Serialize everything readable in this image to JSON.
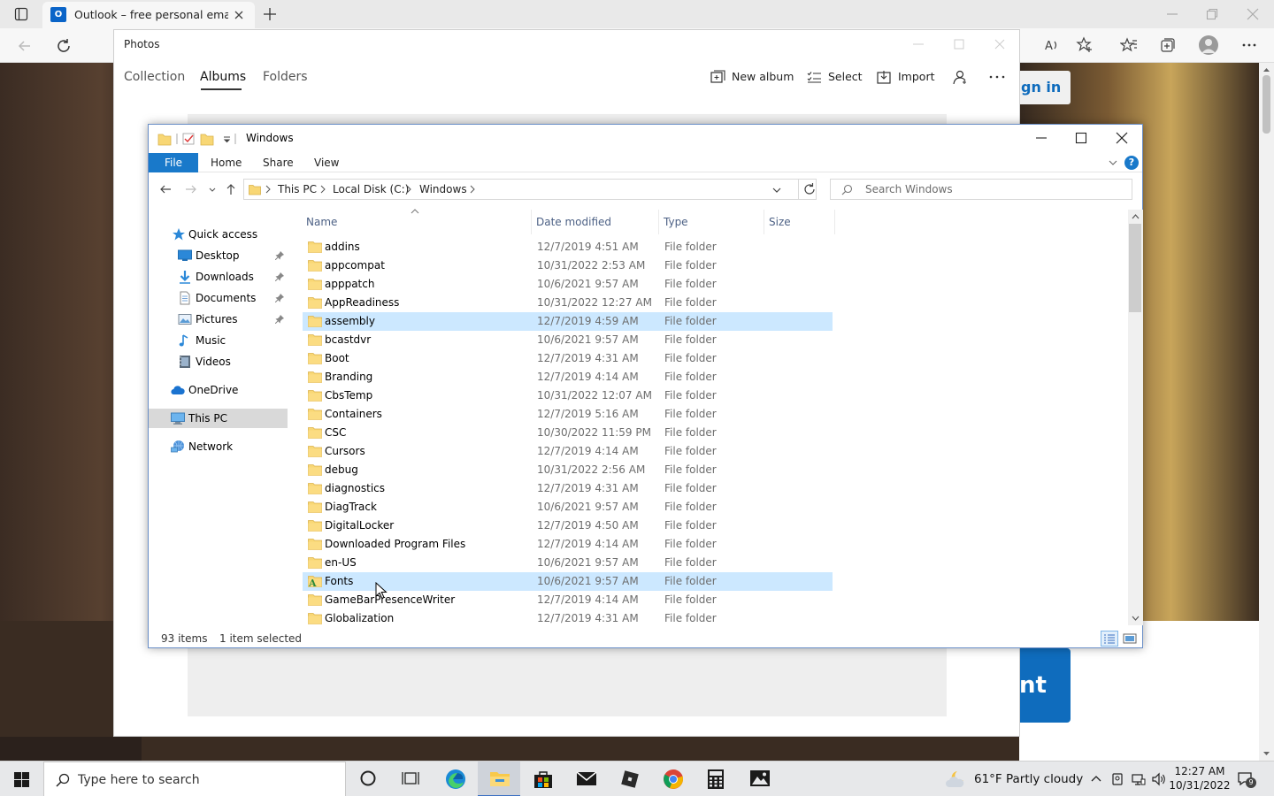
{
  "browser": {
    "tab_title": "Outlook – free personal email an",
    "web_signin_fragment": "gn in",
    "web_button_fragment": "nt"
  },
  "photos": {
    "title": "Photos",
    "nav": [
      "Collection",
      "Albums",
      "Folders"
    ],
    "active_nav": "Albums",
    "actions": {
      "new_album": "New album",
      "select": "Select",
      "import": "Import"
    }
  },
  "explorer": {
    "title": "Windows",
    "ribbon_tabs": [
      "File",
      "Home",
      "Share",
      "View"
    ],
    "breadcrumb": [
      "This PC",
      "Local Disk (C:)",
      "Windows"
    ],
    "search_placeholder": "Search Windows",
    "sidebar": [
      {
        "label": "Quick access",
        "icon": "star-icon"
      },
      {
        "label": "Desktop",
        "icon": "desktop-icon",
        "pinned": true
      },
      {
        "label": "Downloads",
        "icon": "download-icon",
        "pinned": true
      },
      {
        "label": "Documents",
        "icon": "documents-icon",
        "pinned": true
      },
      {
        "label": "Pictures",
        "icon": "pictures-icon",
        "pinned": true
      },
      {
        "label": "Music",
        "icon": "music-icon"
      },
      {
        "label": "Videos",
        "icon": "videos-icon"
      },
      {
        "label": "OneDrive",
        "icon": "cloud-icon"
      },
      {
        "label": "This PC",
        "icon": "computer-icon",
        "selected": true
      },
      {
        "label": "Network",
        "icon": "network-icon"
      }
    ],
    "columns": [
      "Name",
      "Date modified",
      "Type",
      "Size"
    ],
    "files": [
      {
        "name": "addins",
        "date": "12/7/2019 4:51 AM",
        "type": "File folder"
      },
      {
        "name": "appcompat",
        "date": "10/31/2022 2:53 AM",
        "type": "File folder"
      },
      {
        "name": "apppatch",
        "date": "10/6/2021 9:57 AM",
        "type": "File folder"
      },
      {
        "name": "AppReadiness",
        "date": "10/31/2022 12:27 AM",
        "type": "File folder"
      },
      {
        "name": "assembly",
        "date": "12/7/2019 4:59 AM",
        "type": "File folder",
        "selected": true
      },
      {
        "name": "bcastdvr",
        "date": "10/6/2021 9:57 AM",
        "type": "File folder"
      },
      {
        "name": "Boot",
        "date": "12/7/2019 4:31 AM",
        "type": "File folder"
      },
      {
        "name": "Branding",
        "date": "12/7/2019 4:14 AM",
        "type": "File folder"
      },
      {
        "name": "CbsTemp",
        "date": "10/31/2022 12:07 AM",
        "type": "File folder"
      },
      {
        "name": "Containers",
        "date": "12/7/2019 5:16 AM",
        "type": "File folder"
      },
      {
        "name": "CSC",
        "date": "10/30/2022 11:59 PM",
        "type": "File folder"
      },
      {
        "name": "Cursors",
        "date": "12/7/2019 4:14 AM",
        "type": "File folder"
      },
      {
        "name": "debug",
        "date": "10/31/2022 2:56 AM",
        "type": "File folder"
      },
      {
        "name": "diagnostics",
        "date": "12/7/2019 4:31 AM",
        "type": "File folder"
      },
      {
        "name": "DiagTrack",
        "date": "10/6/2021 9:57 AM",
        "type": "File folder"
      },
      {
        "name": "DigitalLocker",
        "date": "12/7/2019 4:50 AM",
        "type": "File folder"
      },
      {
        "name": "Downloaded Program Files",
        "date": "12/7/2019 4:14 AM",
        "type": "File folder"
      },
      {
        "name": "en-US",
        "date": "10/6/2021 9:57 AM",
        "type": "File folder"
      },
      {
        "name": "Fonts",
        "date": "10/6/2021 9:57 AM",
        "type": "File folder",
        "hover": true,
        "fonts_icon": true
      },
      {
        "name": "GameBarPresenceWriter",
        "date": "12/7/2019 4:14 AM",
        "type": "File folder"
      },
      {
        "name": "Globalization",
        "date": "12/7/2019 4:31 AM",
        "type": "File folder"
      }
    ],
    "status": {
      "item_count": "93 items",
      "selection": "1 item selected"
    }
  },
  "taskbar": {
    "search_placeholder": "Type here to search",
    "apps": [
      "cortana-icon",
      "task-view-icon",
      "edge-icon",
      "file-explorer-icon",
      "store-icon",
      "mail-icon",
      "roblox-icon",
      "chrome-icon",
      "calculator-icon",
      "photos-icon"
    ],
    "weather": "61°F  Partly cloudy",
    "time": "12:27 AM",
    "date": "10/31/2022",
    "notifications": "9"
  },
  "colors": {
    "accent": "#1979ca",
    "selection": "#cce8ff",
    "folder": "#f8d775"
  }
}
